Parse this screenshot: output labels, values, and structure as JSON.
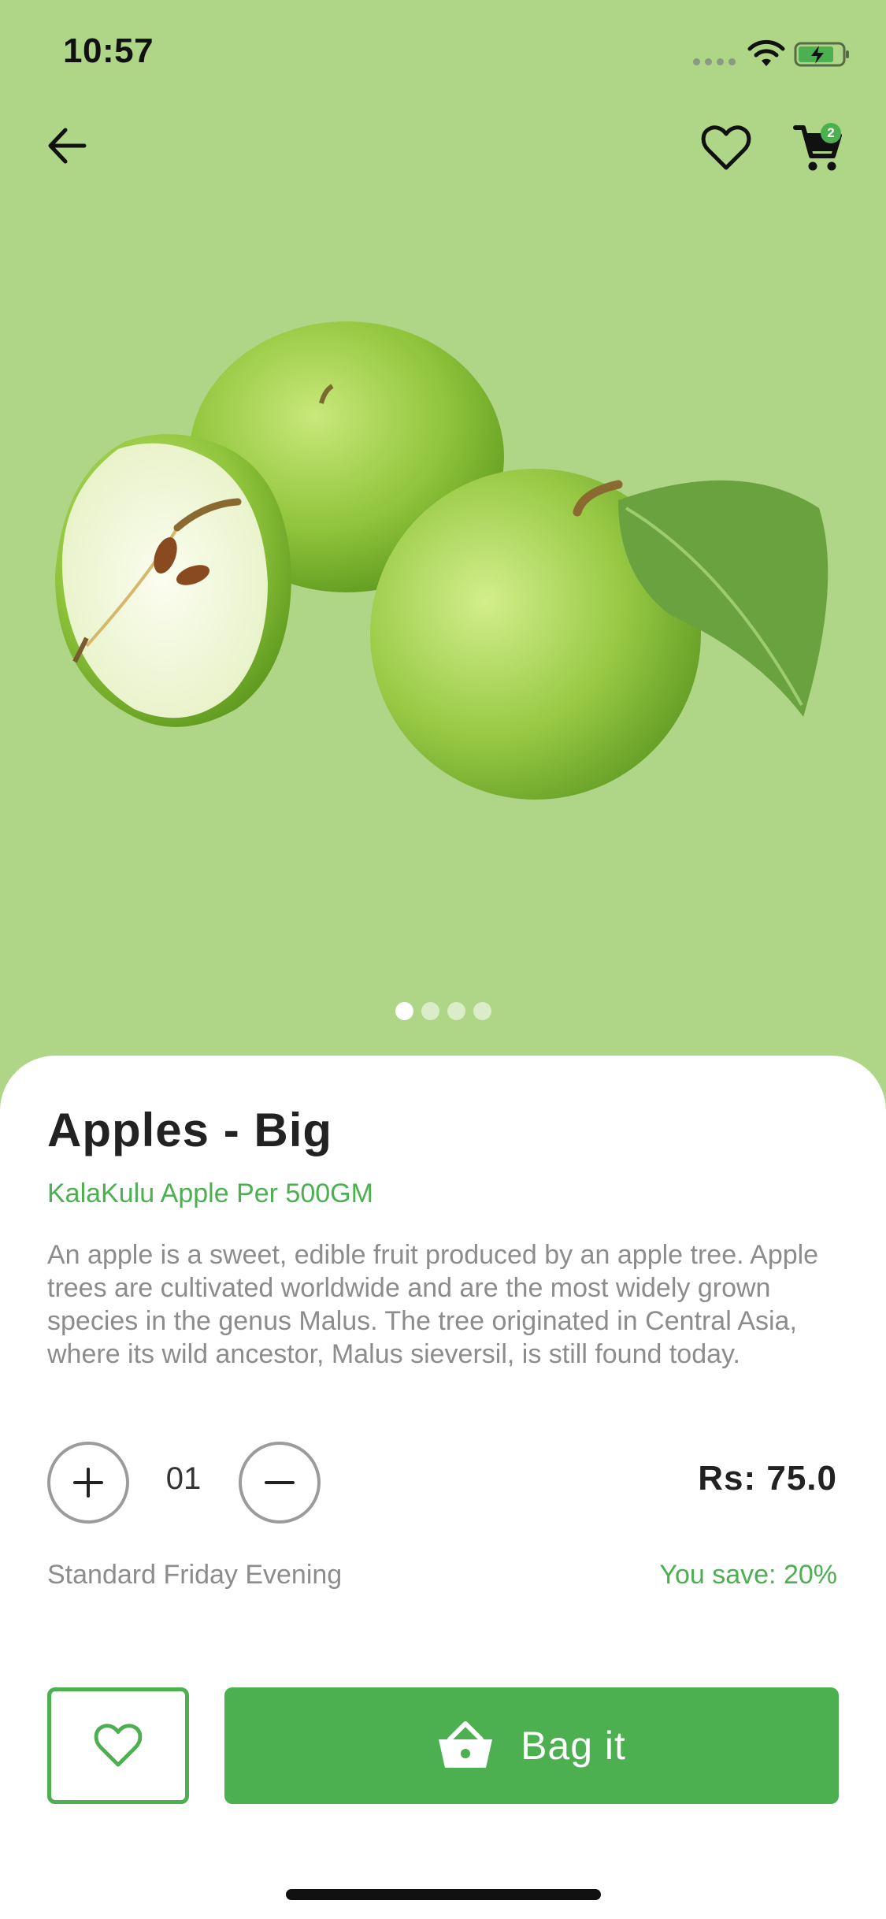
{
  "status_bar": {
    "time": "10:57"
  },
  "header": {
    "cart_count": "2"
  },
  "carousel": {
    "total": 4,
    "active_index": 0
  },
  "product": {
    "title": "Apples - Big",
    "subtitle": "KalaKulu Apple Per 500GM",
    "description": "An apple is a sweet, edible fruit produced by an apple tree. Apple trees are cultivated worldwide and are the most widely grown species in the genus Malus. The tree originated in Central Asia, where its wild ancestor, Malus sieversil, is still found today.",
    "quantity": "01",
    "price": "Rs: 75.0",
    "delivery": "Standard Friday Evening",
    "savings": "You save: 20%"
  },
  "actions": {
    "bag_label": "Bag it"
  },
  "colors": {
    "hero_bg": "#afd587",
    "accent": "#4caf50"
  },
  "icons": [
    "back-arrow-icon",
    "heart-icon",
    "cart-icon",
    "plus-icon",
    "minus-icon",
    "basket-icon",
    "wifi-icon",
    "battery-icon"
  ]
}
